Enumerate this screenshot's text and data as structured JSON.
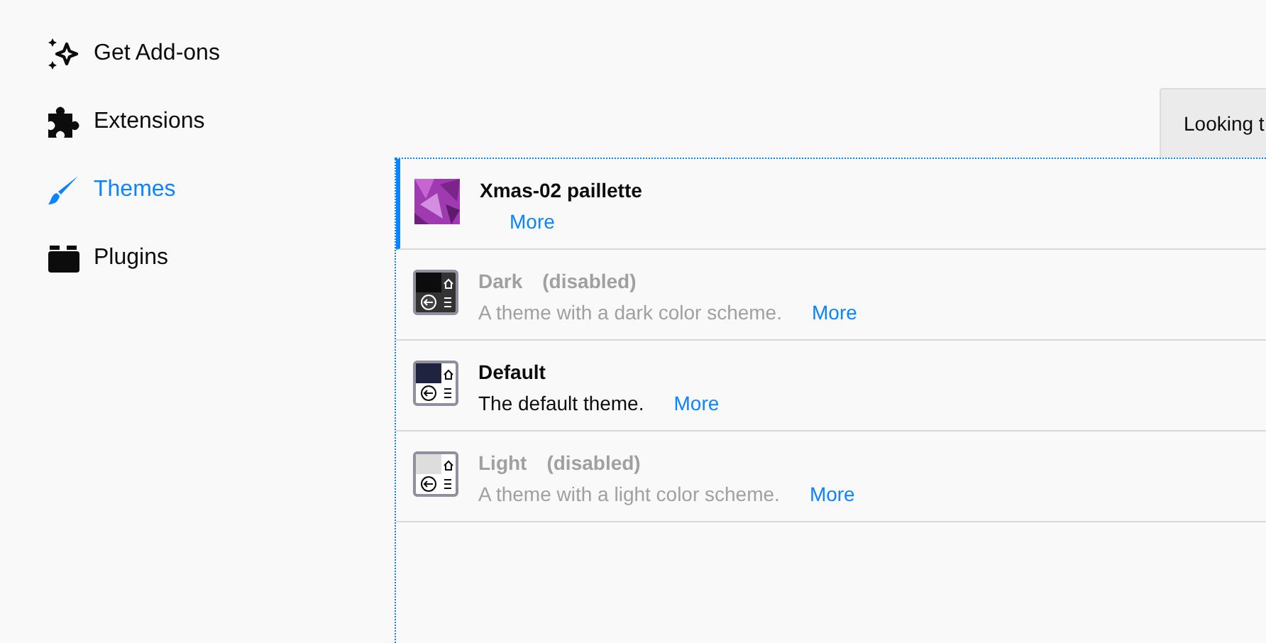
{
  "sidebar": {
    "items": [
      {
        "label": "Get Add-ons",
        "kind": "sparkles",
        "selected": false
      },
      {
        "label": "Extensions",
        "kind": "puzzle",
        "selected": false
      },
      {
        "label": "Themes",
        "kind": "brush",
        "selected": true
      },
      {
        "label": "Plugins",
        "kind": "plugin",
        "selected": false
      }
    ]
  },
  "toolbar": {
    "button": "Looking t"
  },
  "themes": [
    {
      "name": "Xmas-02 paillette",
      "kind": "picture",
      "active": true,
      "disabled": false,
      "more": "More"
    },
    {
      "name": "Dark",
      "kind": "dark",
      "active": false,
      "disabled": true,
      "status": "(disabled)",
      "description": "A theme with a dark color scheme.",
      "more": "More"
    },
    {
      "name": "Default",
      "kind": "default",
      "active": false,
      "disabled": false,
      "description": "The default theme.",
      "more": "More"
    },
    {
      "name": "Light",
      "kind": "light",
      "active": false,
      "disabled": true,
      "status": "(disabled)",
      "description": "A theme with a light color scheme.",
      "more": "More"
    }
  ]
}
